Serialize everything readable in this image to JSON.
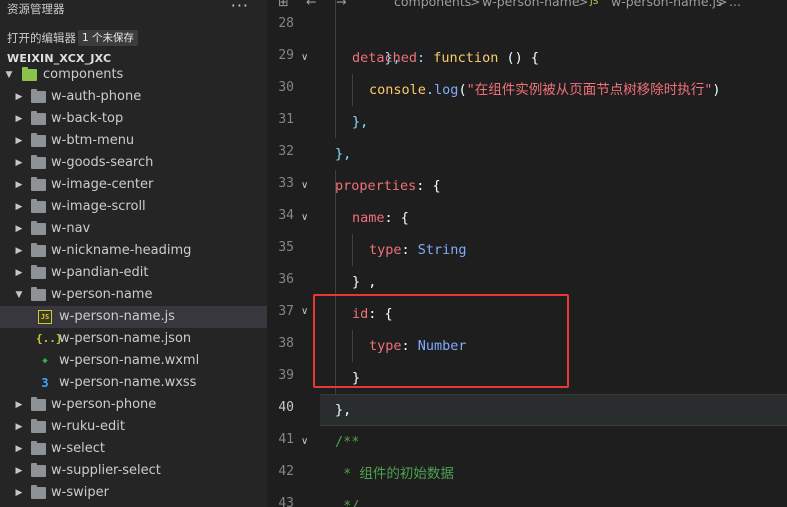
{
  "sidebar": {
    "title": "资源管理器",
    "more": "···",
    "open_editors": {
      "label": "打开的编辑器",
      "badge": "1 个未保存"
    },
    "project": "WEIXIN_XCX_JXC",
    "root_folder": "components",
    "items": [
      {
        "name": "w-auth-phone",
        "type": "folder"
      },
      {
        "name": "w-back-top",
        "type": "folder"
      },
      {
        "name": "w-btm-menu",
        "type": "folder"
      },
      {
        "name": "w-goods-search",
        "type": "folder"
      },
      {
        "name": "w-image-center",
        "type": "folder"
      },
      {
        "name": "w-image-scroll",
        "type": "folder"
      },
      {
        "name": "w-nav",
        "type": "folder"
      },
      {
        "name": "w-nickname-headimg",
        "type": "folder"
      },
      {
        "name": "w-pandian-edit",
        "type": "folder"
      },
      {
        "name": "w-person-name",
        "type": "folder-open"
      },
      {
        "name": "w-person-name.js",
        "type": "js",
        "selected": true
      },
      {
        "name": "w-person-name.json",
        "type": "json"
      },
      {
        "name": "w-person-name.wxml",
        "type": "wxml"
      },
      {
        "name": "w-person-name.wxss",
        "type": "wxss"
      },
      {
        "name": "w-person-phone",
        "type": "folder"
      },
      {
        "name": "w-ruku-edit",
        "type": "folder"
      },
      {
        "name": "w-select",
        "type": "folder"
      },
      {
        "name": "w-supplier-select",
        "type": "folder"
      },
      {
        "name": "w-swiper",
        "type": "folder"
      }
    ],
    "icons": {
      "json": "{..}",
      "wxml": "◈",
      "wxss": "3",
      "js": "JS"
    }
  },
  "editor": {
    "breadcrumb": {
      "sep": ">",
      "parts": [
        "components",
        "w-person-name",
        "w-person-name.js",
        "..."
      ]
    },
    "line_numbers": [
      "28",
      "29",
      "30",
      "31",
      "32",
      "33",
      "34",
      "35",
      "36",
      "37",
      "38",
      "39",
      "40",
      "41",
      "42",
      "43"
    ],
    "active_line": "40",
    "code": {
      "l28_close": "},",
      "l29_key": "detached",
      "l29_colon": ": ",
      "l29_fn": "function",
      "l29_rest": " () {",
      "l30_obj": "console",
      "l30_dot": ".",
      "l30_method": "log",
      "l30_open": "(",
      "l30_str": "\"在组件实例被从页面节点树移除时执行\"",
      "l30_close": ")",
      "l31_close": "},",
      "l32_close": "},",
      "l33_key": "properties",
      "l33_rest": ": {",
      "l34_key": "name",
      "l34_rest": ": {",
      "l35_key": "type",
      "l35_colon": ": ",
      "l35_val": "String",
      "l36_close": "} ,",
      "l37_key": "id",
      "l37_rest": ": {",
      "l38_key": "type",
      "l38_colon": ": ",
      "l38_val": "Number",
      "l39_close": "}",
      "l40_close": "},",
      "l41_comment": "/**",
      "l42_comment": " * 组件的初始数据",
      "l43_comment": " */"
    },
    "highlight_color": "#e53935"
  }
}
